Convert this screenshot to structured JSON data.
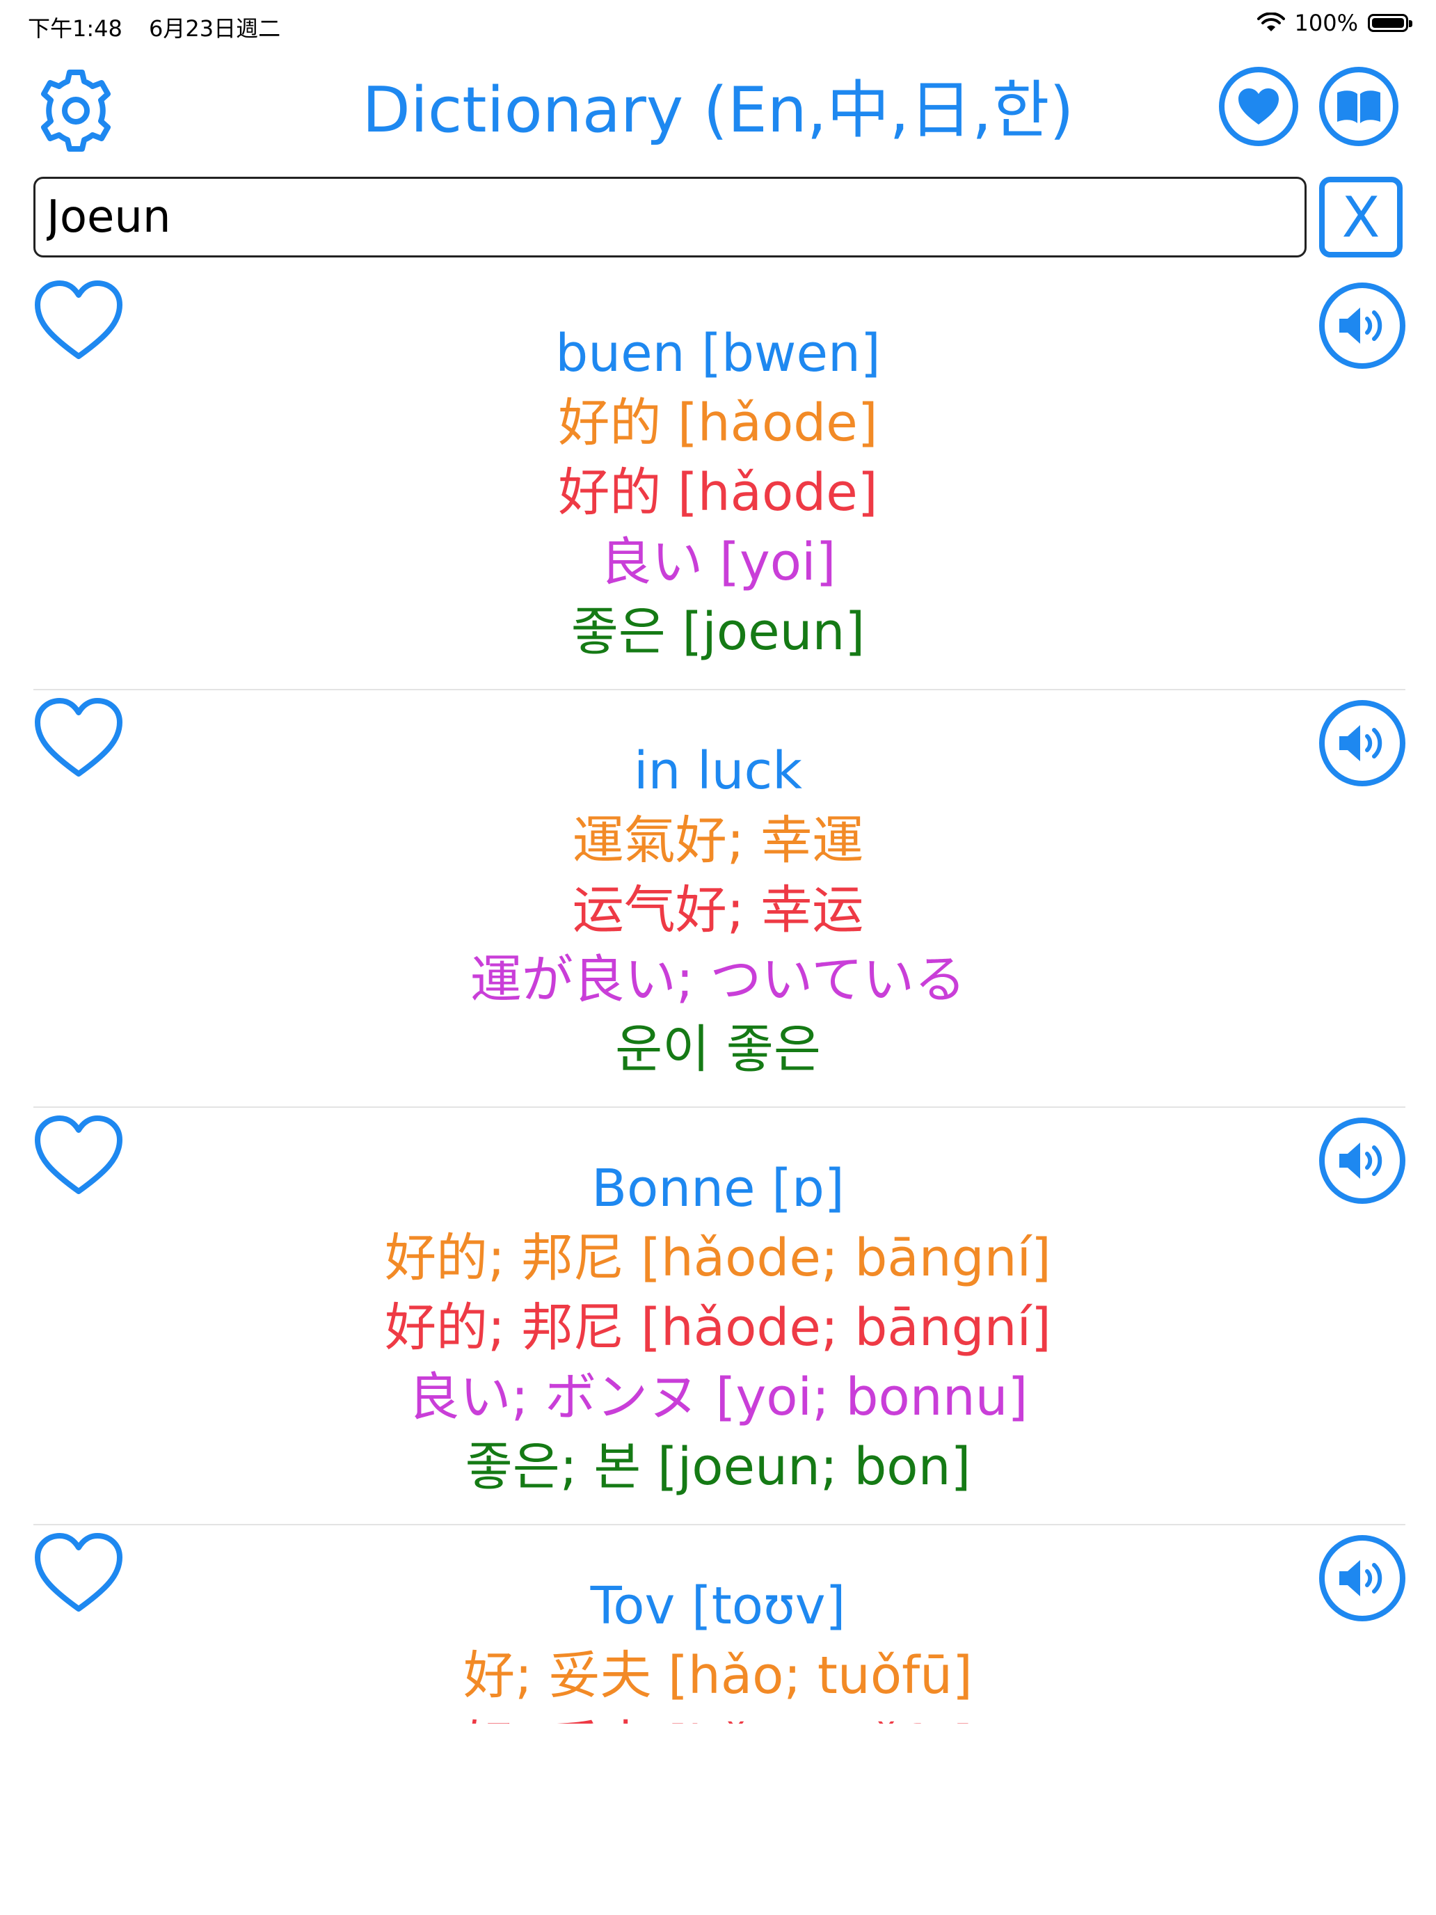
{
  "status_bar": {
    "time": "下午1:48",
    "date": "6月23日週二",
    "battery": "100%"
  },
  "header": {
    "title": "Dictionary (En,中,日,한)"
  },
  "search": {
    "value": "Joeun",
    "clear_label": "X"
  },
  "colors": {
    "accent": "#1e88f0",
    "traditional_chinese": "#f28a26",
    "simplified_chinese": "#ee3a45",
    "japanese": "#c93ed8",
    "korean": "#157a15"
  },
  "results": [
    {
      "en": "buen [bwen]",
      "zh_tw": "好的 [hǎode]",
      "zh_cn": "好的 [hǎode]",
      "ja": "良い [yoi]",
      "ko": "좋은 [joeun]"
    },
    {
      "en": "in luck",
      "zh_tw": "運氣好; 幸運",
      "zh_cn": "运气好; 幸运",
      "ja": "運が良い; ついている",
      "ko": "운이 좋은"
    },
    {
      "en": "Bonne [ɒ]",
      "zh_tw": "好的; 邦尼 [hǎode; bāngní]",
      "zh_cn": "好的; 邦尼 [hǎode; bāngní]",
      "ja": "良い; ボンヌ [yoi; bonnu]",
      "ko": "좋은; 본 [joeun; bon]"
    },
    {
      "en": "Tov [toʊv]",
      "zh_tw": "好; 妥夫 [hǎo; tuǒfū]",
      "zh_cn": "好; 妥夫 [hǎo; tuǒfū]",
      "ja": "",
      "ko": ""
    }
  ]
}
